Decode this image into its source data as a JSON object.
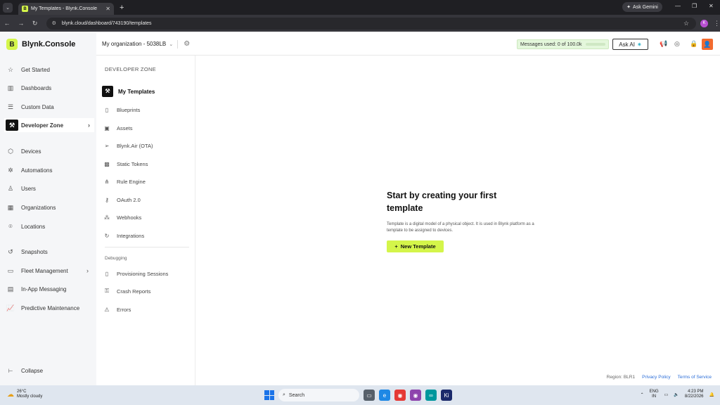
{
  "browser": {
    "tab_title": "My Templates - Blynk.Console",
    "tab_favicon": "B",
    "url": "blynk.cloud/dashboard/743190/templates",
    "ask_gemini": "Ask Gemini",
    "profile_initial": "K"
  },
  "app": {
    "logo_letter": "B",
    "logo_name": "Blynk.Console",
    "org_name": "My organization - 5038LB",
    "messages_used": "Messages used: 0 of 100.0k",
    "ask_ai": "Ask AI",
    "accent_color": "#d4f54a"
  },
  "sidebar": {
    "items": [
      {
        "label": "Get Started",
        "icon": "star-icon"
      },
      {
        "label": "Dashboards",
        "icon": "bar-chart-icon"
      },
      {
        "label": "Custom Data",
        "icon": "database-icon"
      },
      {
        "label": "Developer Zone",
        "icon": "developer-icon",
        "active": true
      },
      {
        "label": "Devices",
        "icon": "cube-icon"
      },
      {
        "label": "Automations",
        "icon": "automation-icon"
      },
      {
        "label": "Users",
        "icon": "users-icon"
      },
      {
        "label": "Organizations",
        "icon": "building-icon"
      },
      {
        "label": "Locations",
        "icon": "pin-icon"
      },
      {
        "label": "Snapshots",
        "icon": "snapshot-icon"
      },
      {
        "label": "Fleet Management",
        "icon": "truck-icon"
      },
      {
        "label": "In-App Messaging",
        "icon": "message-icon"
      },
      {
        "label": "Predictive Maintenance",
        "icon": "trend-icon"
      }
    ],
    "collapse": "Collapse"
  },
  "dev_zone": {
    "title": "DEVELOPER ZONE",
    "items": [
      {
        "label": "My Templates",
        "active": true
      },
      {
        "label": "Blueprints"
      },
      {
        "label": "Assets"
      },
      {
        "label": "Blynk.Air (OTA)"
      },
      {
        "label": "Static Tokens"
      },
      {
        "label": "Rule Engine"
      },
      {
        "label": "OAuth 2.0"
      },
      {
        "label": "Webhooks"
      },
      {
        "label": "Integrations"
      }
    ],
    "debugging_title": "Debugging",
    "debugging_items": [
      {
        "label": "Provisioning Sessions"
      },
      {
        "label": "Crash Reports"
      },
      {
        "label": "Errors"
      }
    ]
  },
  "main": {
    "empty_title": "Start by creating your first template",
    "empty_desc": "Template is a digital model of a physical object. It is used in Blynk platform as a template to be assigned to devices.",
    "new_template": "New Template",
    "region": "Region: BLR1",
    "privacy": "Privacy Policy",
    "terms": "Terms of Service"
  },
  "taskbar": {
    "temp": "26°C",
    "weather": "Mostly cloudy",
    "search": "Search",
    "lang1": "ENG",
    "lang2": "IN",
    "time": "4:23 PM",
    "date": "8/22/2026"
  }
}
